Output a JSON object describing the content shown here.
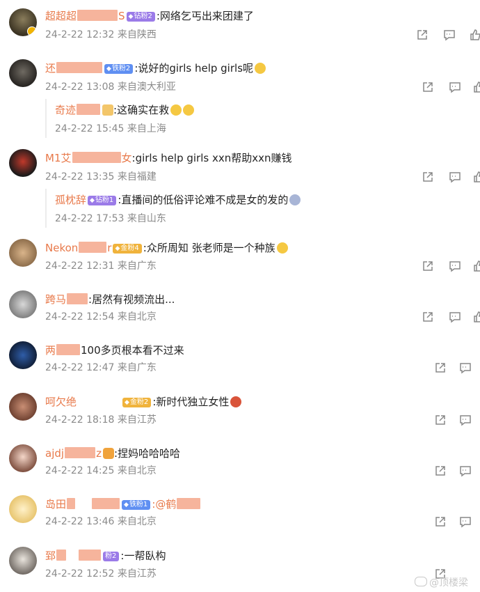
{
  "comments": [
    {
      "user": "超超超",
      "user_tail": "S",
      "badge": "钻粉2",
      "badge_type": "purple",
      "text": ":网络乞丐出来团建了",
      "emoji": "",
      "date": "24-2-22 12:32",
      "loc": "来自陕西"
    },
    {
      "user": "还",
      "user_tail": "",
      "badge": "铁粉2",
      "badge_type": "blue",
      "text": ":说好的girls help girls呢",
      "emoji": "dog",
      "date": "24-2-22 13:08",
      "loc": "来自澳大利亚",
      "reply": {
        "user": "奇迹",
        "badge": "",
        "text": ":这确实在救",
        "emoji": "smile2",
        "date": "24-2-22 15:45",
        "loc": "来自上海"
      }
    },
    {
      "user": "M1艾",
      "user_tail": "女",
      "badge": "",
      "badge_type": "",
      "text": ":girls help girls  xxn帮助xxn赚钱",
      "emoji": "",
      "date": "24-2-22 13:35",
      "loc": "来自福建",
      "reply": {
        "user": "孤枕辞",
        "badge": "钻粉1",
        "text": ":直播间的低俗评论难不成是女的发的",
        "emoji": "scared",
        "date": "24-2-22 17:53",
        "loc": "来自山东"
      }
    },
    {
      "user": "Nekon",
      "user_tail": "r",
      "badge": "金粉4",
      "badge_type": "gold",
      "text": ":众所周知 张老师是一个种族",
      "emoji": "dog",
      "date": "24-2-22 12:31",
      "loc": "来自广东"
    },
    {
      "user": "跨马",
      "user_tail": "",
      "badge": "",
      "badge_type": "",
      "text": ":居然有视频流出...",
      "emoji": "",
      "date": "24-2-22 12:54",
      "loc": "来自北京"
    },
    {
      "user": "两",
      "user_tail": "",
      "badge": "",
      "badge_type": "",
      "text": "100多页根本看不过来",
      "emoji": "",
      "date": "24-2-22 12:47",
      "loc": "来自广东"
    },
    {
      "user": "呵欠绝",
      "user_tail": "",
      "badge": "金粉2",
      "badge_type": "gold",
      "text": ":新时代独立女性",
      "emoji": "crab",
      "date": "24-2-22 18:18",
      "loc": "来自江苏"
    },
    {
      "user": "ajdj",
      "user_tail": "z",
      "badge": "",
      "badge_type": "",
      "text": ":捏妈哈哈哈哈",
      "emoji": "",
      "date": "24-2-22 14:25",
      "loc": "来自北京"
    },
    {
      "user": "岛田",
      "user_tail": "",
      "badge": "铁粉1",
      "badge_type": "blue",
      "text": ":@鹤",
      "emoji": "",
      "date": "24-2-22 13:46",
      "loc": "来自北京"
    },
    {
      "user": "郅",
      "user_tail": "",
      "badge": "粉2",
      "badge_type": "purple",
      "text": ":一帮臥构",
      "emoji": "",
      "date": "24-2-22 12:52",
      "loc": "来自江苏"
    }
  ],
  "watermark": "@顶楼梁",
  "colors": {
    "username": "#e8794a",
    "meta": "#8a8a8a",
    "redaction": "#f6b49c"
  },
  "icons": [
    "share-icon",
    "comment-icon",
    "like-icon"
  ]
}
